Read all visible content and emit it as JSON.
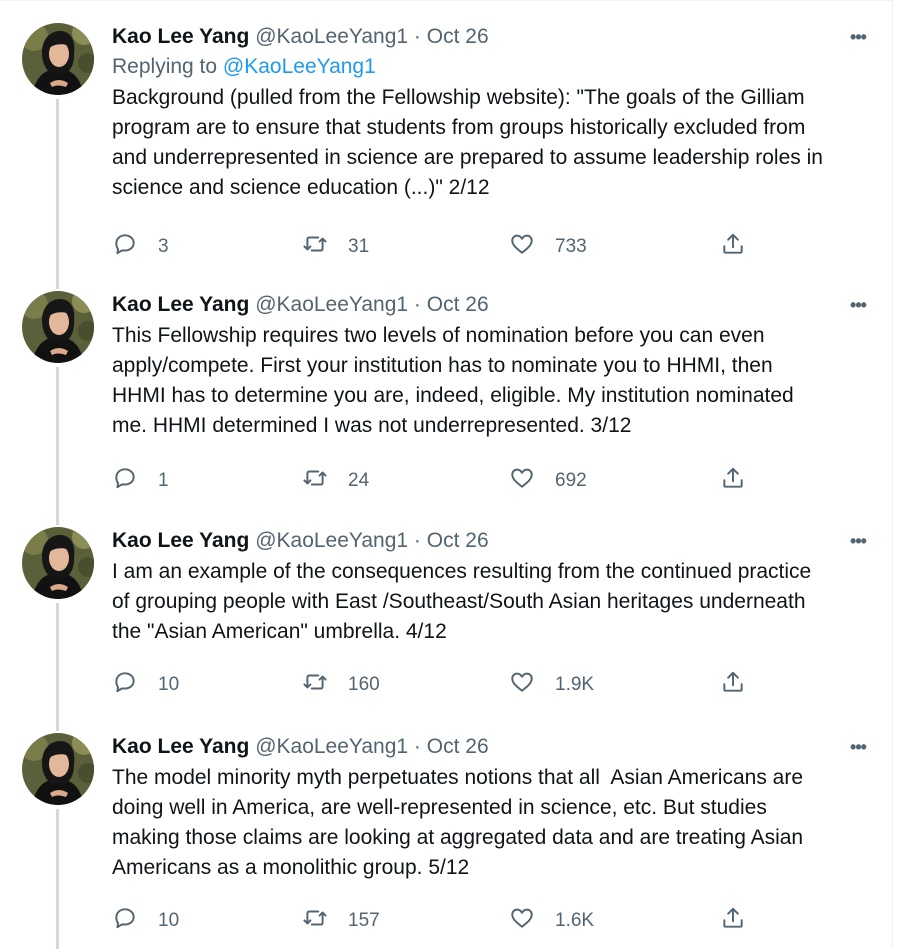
{
  "tweets": [
    {
      "name": "Kao Lee Yang",
      "handle": "@KaoLeeYang1",
      "separator": "·",
      "date": "Oct 26",
      "replying_prefix": "Replying to",
      "replying_to": "@KaoLeeYang1",
      "text": "Background (pulled from the Fellowship website): \"The goals of the Gilliam\nprogram are to ensure that students from groups historically excluded from\nand underrepresented in science are prepared to assume leadership roles in\nscience and science education (...)\" 2/12",
      "replies": "3",
      "retweets": "31",
      "likes": "733"
    },
    {
      "name": "Kao Lee Yang",
      "handle": "@KaoLeeYang1",
      "separator": "·",
      "date": "Oct 26",
      "text": "This Fellowship requires two levels of nomination before you can even\napply/compete. First your institution has to nominate you to HHMI, then\nHHMI has to determine you are, indeed, eligible. My institution nominated\nme. HHMI determined I was not underrepresented. 3/12",
      "replies": "1",
      "retweets": "24",
      "likes": "692"
    },
    {
      "name": "Kao Lee Yang",
      "handle": "@KaoLeeYang1",
      "separator": "·",
      "date": "Oct 26",
      "text": "I am an example of the consequences resulting from the continued practice\nof grouping people with East /Southeast/South Asian heritages underneath\nthe \"Asian American\" umbrella. 4/12",
      "replies": "10",
      "retweets": "160",
      "likes": "1.9K"
    },
    {
      "name": "Kao Lee Yang",
      "handle": "@KaoLeeYang1",
      "separator": "·",
      "date": "Oct 26",
      "text": "The model minority myth perpetuates notions that all  Asian Americans are\ndoing well in America, are well-represented in science, etc. But studies\nmaking those claims are looking at aggregated data and are treating Asian\nAmericans as a monolithic group. 5/12",
      "replies": "10",
      "retweets": "157",
      "likes": "1.6K"
    }
  ],
  "icons": {
    "reply": "reply-icon",
    "retweet": "retweet-icon",
    "like": "heart-icon",
    "share": "share-icon",
    "more": "more-icon"
  },
  "colors": {
    "text": "#0f1419",
    "secondary": "#536471",
    "link": "#1d9bf0",
    "thread_line": "#cfd9de"
  }
}
